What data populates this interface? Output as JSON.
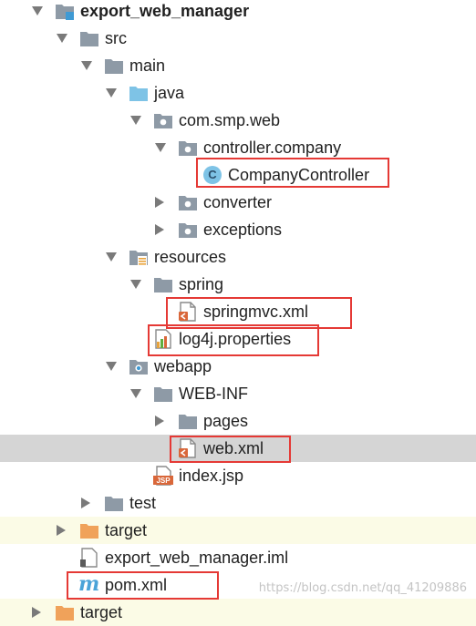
{
  "tree": {
    "project": "export_web_manager",
    "src": "src",
    "main": "main",
    "java": "java",
    "package": "com.smp.web",
    "controller_pkg": "controller.company",
    "controller_class": "CompanyController",
    "class_badge": "C",
    "converter": "converter",
    "exceptions": "exceptions",
    "resources": "resources",
    "spring": "spring",
    "springmvc_xml": "springmvc.xml",
    "log4j": "log4j.properties",
    "webapp": "webapp",
    "webinf": "WEB-INF",
    "pages": "pages",
    "web_xml": "web.xml",
    "index_jsp": "index.jsp",
    "jsp_badge": "JSP",
    "test": "test",
    "target": "target",
    "iml": "export_web_manager.iml",
    "pom_badge": "m",
    "pom": "pom.xml",
    "target_bottom": "target"
  },
  "watermark": "https://blog.csdn.net/qq_41209886",
  "colors": {
    "folder": "#8e9aa6",
    "source_folder": "#7ec3e6",
    "highlight": "#e53935",
    "selection": "#d5d5d5",
    "excluded_row": "#fbfbe6",
    "target_folder": "#f0a25a"
  },
  "icons": {
    "expanded": "chevron-down-icon",
    "collapsed": "chevron-right-icon",
    "folder": "folder-icon",
    "package": "package-icon",
    "class": "java-class-icon",
    "xml": "xml-file-icon",
    "properties": "properties-file-icon",
    "jsp": "jsp-file-icon",
    "maven": "maven-icon"
  }
}
